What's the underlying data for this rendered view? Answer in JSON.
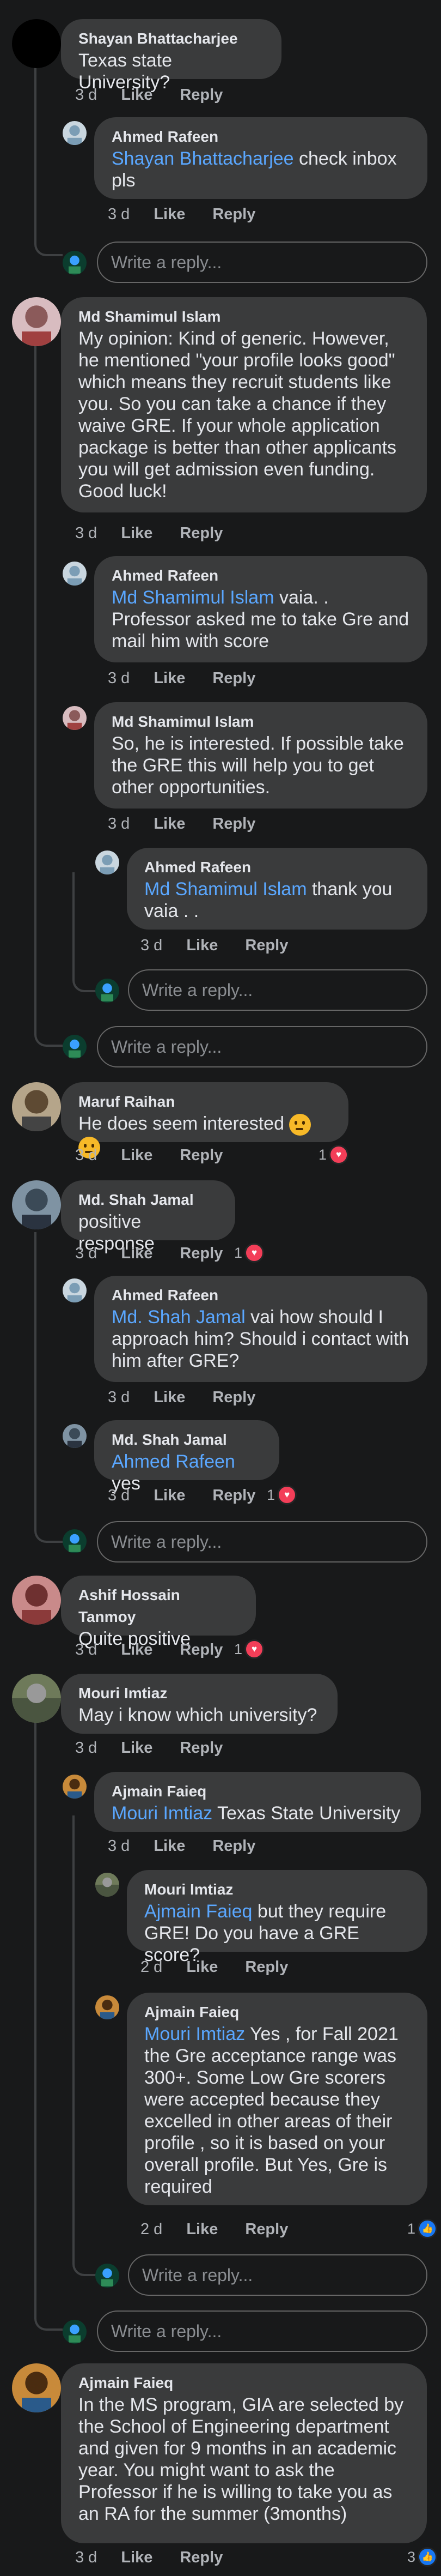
{
  "labels": {
    "like": "Like",
    "reply": "Reply"
  },
  "reply_placeholder": "Write a reply...",
  "c1": {
    "name": "Shayan Bhattacharjee",
    "text": "Texas state University?",
    "time": "3 d"
  },
  "c1r1": {
    "name": "Ahmed Rafeen",
    "mention": "Shayan Bhattacharjee",
    "text": " check inbox pls",
    "time": "3 d"
  },
  "c2": {
    "name": "Md Shamimul Islam",
    "text": "My opinion: Kind of generic. However, he mentioned \"your profile looks good\" which means they recruit students like you. So you can take a chance if they waive GRE. If your whole application package is better than other applicants you will get admission even funding. Good luck!",
    "time": "3 d"
  },
  "c2r1": {
    "name": "Ahmed Rafeen",
    "mention": "Md Shamimul Islam",
    "text": " vaia. . Professor asked me to take Gre and mail him with score",
    "time": "3 d"
  },
  "c2r2": {
    "name": "Md Shamimul Islam",
    "text": "So, he is interested. If possible take the GRE this will help you to get other opportunities.",
    "time": "3 d"
  },
  "c2r3": {
    "name": "Ahmed Rafeen",
    "mention": "Md Shamimul Islam",
    "text": " thank you vaia . .",
    "time": "3 d"
  },
  "c3": {
    "name": "Maruf Raihan",
    "text": "He does seem interested",
    "time": "3 d",
    "reactions": "1"
  },
  "c4": {
    "name": "Md. Shah Jamal",
    "text": "positive response",
    "time": "3 d",
    "reactions": "1"
  },
  "c4r1": {
    "name": "Ahmed Rafeen",
    "mention": "Md. Shah Jamal",
    "text": " vai how should I approach him? Should i contact with him after GRE?",
    "time": "3 d"
  },
  "c4r2": {
    "name": "Md. Shah Jamal",
    "mention": "Ahmed Rafeen",
    "text": " yes",
    "time": "3 d",
    "reactions": "1"
  },
  "c5": {
    "name": "Ashif Hossain Tanmoy",
    "text": "Quite positive",
    "time": "3 d",
    "reactions": "1"
  },
  "c6": {
    "name": "Mouri Imtiaz",
    "text": "May i know which university?",
    "time": "3 d"
  },
  "c6r1": {
    "name": "Ajmain Faieq",
    "mention": "Mouri Imtiaz",
    "text": " Texas State University",
    "time": "3 d"
  },
  "c6r2": {
    "name": "Mouri Imtiaz",
    "mention": "Ajmain Faieq",
    "text": " but they require GRE! Do you have a GRE score?",
    "time": "2 d"
  },
  "c6r3": {
    "name": "Ajmain Faieq",
    "mention": "Mouri Imtiaz",
    "text": " Yes , for Fall 2021 the Gre acceptance range was 300+. Some Low Gre scorers were accepted because they excelled in other areas of their profile , so it is based on your overall profile. But Yes, Gre is required",
    "time": "2 d",
    "reactions": "1"
  },
  "c7": {
    "name": "Ajmain Faieq",
    "text": "In the MS program, GIA are selected by the School of Engineering department and given for 9 months in an academic year. You might want to ask the Professor if he is willing to take you as an RA for the summer (3months)",
    "time": "3 d",
    "reactions": "3"
  }
}
